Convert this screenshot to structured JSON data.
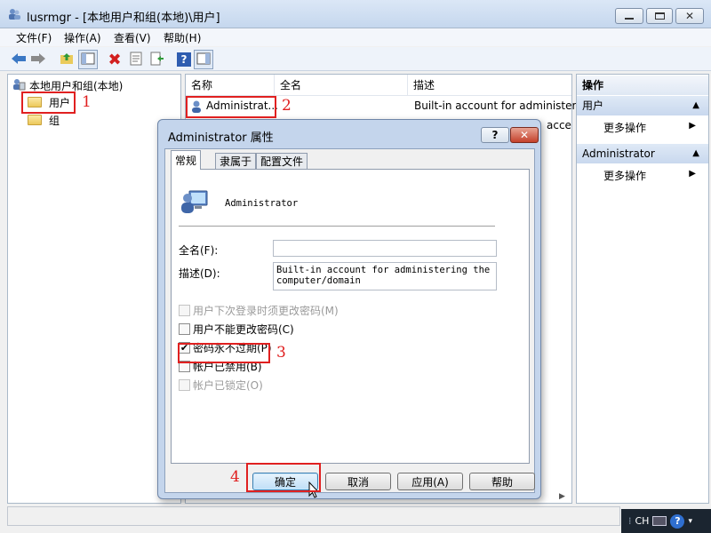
{
  "window": {
    "title": "lusrmgr - [本地用户和组(本地)\\用户]"
  },
  "menu": [
    "文件(F)",
    "操作(A)",
    "查看(V)",
    "帮助(H)"
  ],
  "tree": {
    "root": "本地用户和组(本地)",
    "items": [
      "用户",
      "组"
    ]
  },
  "list": {
    "columns": [
      "名称",
      "全名",
      "描述"
    ],
    "rows": [
      {
        "name": "Administrat...",
        "description": "Built-in account for administer"
      }
    ],
    "partial_text": "acce"
  },
  "actions": {
    "header": "操作",
    "sections": [
      {
        "title": "用户",
        "item": "更多操作"
      },
      {
        "title": "Administrator",
        "item": "更多操作"
      }
    ]
  },
  "dialog": {
    "title": "Administrator 属性",
    "help_button": "?",
    "tabs": [
      "常规",
      "隶属于",
      "配置文件"
    ],
    "username": "Administrator",
    "fullname_label": "全名(F):",
    "fullname_value": "",
    "description_label": "描述(D):",
    "description_value": "Built-in account for administering the computer/domain",
    "checkboxes": [
      {
        "label": "用户下次登录时须更改密码(M)",
        "checked": false,
        "disabled": true
      },
      {
        "label": "用户不能更改密码(C)",
        "checked": false,
        "disabled": false
      },
      {
        "label": "密码永不过期(P)",
        "checked": true,
        "disabled": false
      },
      {
        "label": "帐户已禁用(B)",
        "checked": false,
        "disabled": false
      },
      {
        "label": "帐户已锁定(O)",
        "checked": false,
        "disabled": true
      }
    ],
    "buttons": [
      "确定",
      "取消",
      "应用(A)",
      "帮助"
    ]
  },
  "annotations": [
    "1",
    "2",
    "3",
    "4"
  ],
  "tray": {
    "lang": "CH"
  },
  "colors": {
    "annotation": "#e02020",
    "dialog_frame": "#c4d5ec",
    "accent": "#3c7fb1"
  }
}
